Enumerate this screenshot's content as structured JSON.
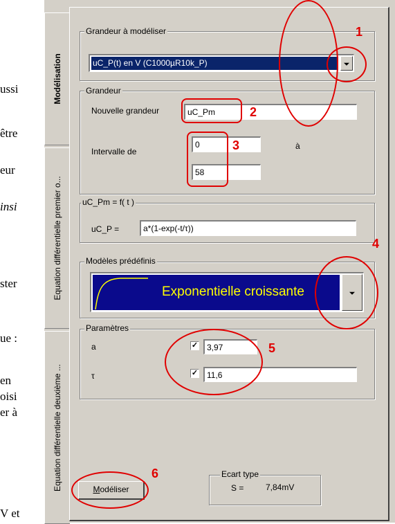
{
  "page_fragments": [
    "ussi",
    "être",
    "eur",
    "insi",
    "ster",
    "ue :",
    "en",
    "oisi",
    "er à",
    "V et"
  ],
  "tabs": [
    {
      "label": "Modélisation"
    },
    {
      "label": "Equation différentielle premier o..."
    },
    {
      "label": "Equation différentielle deuxième ..."
    }
  ],
  "grandeur_modeliser": {
    "title": "Grandeur à modéliser",
    "selected": "uC_P(t) en V (C1000µR10k_P)"
  },
  "grandeur": {
    "title": "Grandeur",
    "new_label": "Nouvelle grandeur",
    "new_value": "uC_Pm",
    "interval_label": "Intervalle de",
    "from": "0",
    "to_word": "à",
    "to": "58"
  },
  "formula": {
    "title": "uC_Pm = f( t )",
    "label": "uC_P =",
    "value": "a*(1-exp(-t/τ))"
  },
  "predefined": {
    "title": "Modèles prédéfinis",
    "selected": "Exponentielle croissante"
  },
  "params": {
    "title": "Paramètres",
    "items": [
      {
        "name": "a",
        "checked": "☑",
        "value": "3,97"
      },
      {
        "name": "τ",
        "checked": "☑",
        "value": "11,6"
      }
    ]
  },
  "model_button": {
    "label_u": "M",
    "label_rest": "odéliser"
  },
  "ecart": {
    "title": "Ecart type",
    "s_label": "S =",
    "s_value": "7,84mV"
  },
  "annotations": [
    "1",
    "2",
    "3",
    "4",
    "5",
    "6"
  ],
  "colors": {
    "annotation": "#e00000",
    "selection": "#0a246a",
    "preset_text": "#ffff00",
    "window": "#d4d0c8"
  }
}
